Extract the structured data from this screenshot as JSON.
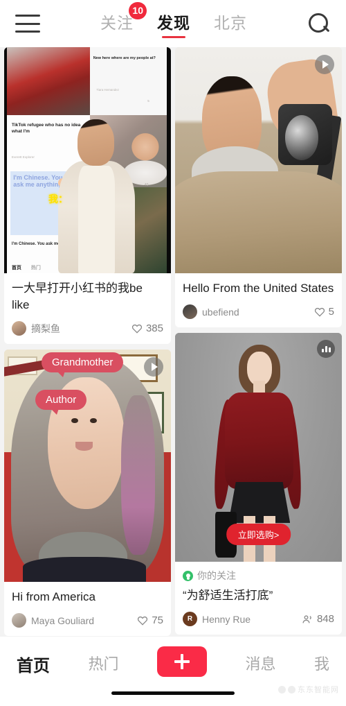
{
  "topbar": {
    "menu_icon": "hamburger-menu-icon",
    "search_icon": "search-icon",
    "tabs": [
      {
        "label": "关注",
        "badge": "10",
        "active": false
      },
      {
        "label": "发现",
        "badge": "",
        "active": true
      },
      {
        "label": "北京",
        "badge": "",
        "active": false
      }
    ]
  },
  "feed": {
    "cards": [
      {
        "title": "一大早打开小红书的我be like",
        "author": "摘梨鱼",
        "likes": "385",
        "metric_icon": "heart-icon",
        "overlay_icon": "",
        "nested": {
          "headline_1": "New here where are my people at?",
          "headline_2": "TikTok refugee who has no idea what I'm",
          "headline_3": "I'm Chinese. You ask me anything",
          "big_text": "I'm Chinese. You can ask me anything",
          "overlay_text": "我：",
          "user_0": "Tiara Hernandez",
          "user_1": "Everett Explorer",
          "like_0": "5",
          "like_1": "40",
          "nav_1": "首页",
          "nav_2": "热门"
        }
      },
      {
        "title": "Hello From the United States",
        "author": "ubefiend",
        "likes": "5",
        "metric_icon": "heart-icon",
        "overlay_icon": "play-icon"
      },
      {
        "title": "Hi from America",
        "author": "Maya Gouliard",
        "likes": "75",
        "metric_icon": "heart-icon",
        "overlay_icon": "play-icon",
        "bubbles": [
          "Grandmother",
          "Author"
        ]
      },
      {
        "follow_label": "你的关注",
        "follow_icon": "person-circle-icon",
        "title": "“为舒适生活打底”",
        "author": "Henny Rue",
        "likes": "848",
        "metric_icon": "people-icon",
        "overlay_icon": "bar-chart-icon",
        "cta": "立即选购>"
      }
    ]
  },
  "bottomnav": {
    "items": [
      {
        "label": "首页",
        "active": true
      },
      {
        "label": "热门",
        "active": false
      },
      {
        "label": "",
        "active": false,
        "icon": "plus-icon"
      },
      {
        "label": "消息",
        "active": false
      },
      {
        "label": "我",
        "active": false
      }
    ]
  },
  "watermark": {
    "text": "东东智能网"
  },
  "colors": {
    "accent_red": "#fa2b47",
    "badge_red": "#f0293c",
    "tab_underline": "#e8333f",
    "bubble_pink": "#d94f61",
    "cta_red": "#e0232e",
    "follow_green": "#34c06a",
    "bg_gray": "#f3f3f3"
  }
}
